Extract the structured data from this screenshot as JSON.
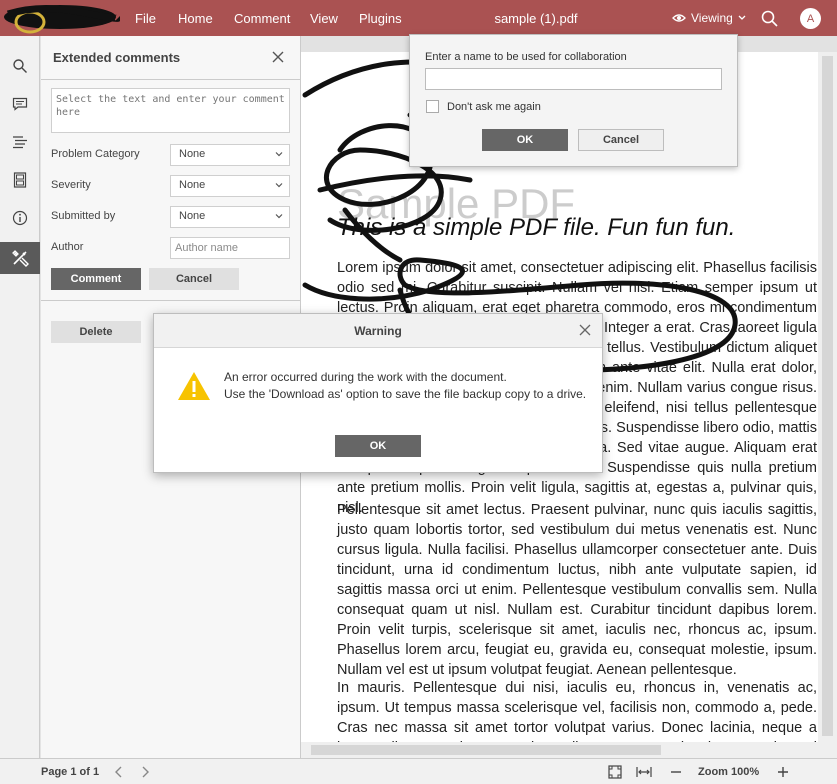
{
  "topbar": {
    "menu": [
      "File",
      "Home",
      "Comment",
      "View",
      "Plugins"
    ],
    "doc_title": "sample (1).pdf",
    "mode": "Viewing",
    "avatar": "A"
  },
  "panel": {
    "title": "Extended comments",
    "comment_placeholder": "Select the text and enter your comment here",
    "problem_category_label": "Problem Category",
    "problem_category_value": "None",
    "severity_label": "Severity",
    "severity_value": "None",
    "submitted_by_label": "Submitted by",
    "submitted_by_value": "None",
    "author_label": "Author",
    "author_placeholder": "Author name",
    "comment_button": "Comment",
    "cancel_button": "Cancel",
    "delete_button": "Delete"
  },
  "document": {
    "title": "Sample PDF",
    "subtitle": "This is a simple PDF file. Fun fun fun.",
    "paragraphs": [
      "Lorem ipsum dolor sit amet, consectetuer adipiscing elit. Phasellus facilisis odio sed mi. Curabitur suscipit. Nullam vel nisi. Etiam semper ipsum ut lectus. Proin aliquam, erat eget pharetra commodo, eros mi condimentum quam, sed commodo justo quam ut velit. Integer a erat. Cras laoreet ligula cursus enim. Aenean scelerisque velit et tellus. Vestibulum dictum aliquet sem. Nulla facilisi. Vestibulum accumsan ante vitae elit. Nulla erat dolor, blandit in, rutrum quis, semper pulvinar, enim. Nullam varius congue risus. Vivamus sollicitudin, metus ut interdum eleifend, nisi tellus pellentesque elit, tristique accumsan eros quam et risus. Suspendisse libero odio, mattis sit amet, aliquet eget, hendrerit vel, nulla. Sed vitae augue. Aliquam erat volutpat. Aliquam feugiat vulputate nisl. Suspendisse quis nulla pretium ante pretium mollis. Proin velit ligula, sagittis at, egestas a, pulvinar quis, nisl.",
      "Pellentesque sit amet lectus. Praesent pulvinar, nunc quis iaculis sagittis, justo quam lobortis tortor, sed vestibulum dui metus venenatis est. Nunc cursus ligula. Nulla facilisi. Phasellus ullamcorper consectetuer ante. Duis tincidunt, urna id condimentum luctus, nibh ante vulputate sapien, id sagittis massa orci ut enim. Pellentesque vestibulum convallis sem. Nulla consequat quam ut nisl. Nullam est. Curabitur tincidunt dapibus lorem. Proin velit turpis, scelerisque sit amet, iaculis nec, rhoncus ac, ipsum. Phasellus lorem arcu, feugiat eu, gravida eu, consequat molestie, ipsum. Nullam vel est ut ipsum volutpat feugiat. Aenean pellentesque.",
      "In mauris. Pellentesque dui nisi, iaculis eu, rhoncus in, venenatis ac, ipsum. Ut tempus massa scelerisque vel, facilisis non, commodo a, pede. Cras nec massa sit amet tortor volutpat varius. Donec lacinia, neque a luctus aliquet, pede massa imperdiet ante, at varius lorem pede sed sapien. Fusce erat nibh, aliquet in, eleifend eget, commodo eget, erat."
    ]
  },
  "collab_dialog": {
    "label": "Enter a name to be used for collaboration",
    "checkbox_label": "Don't ask me again",
    "ok": "OK",
    "cancel": "Cancel"
  },
  "warning_dialog": {
    "title": "Warning",
    "line1": "An error occurred during the work with the document.",
    "line2": "Use the 'Download as' option to save the file backup copy to a drive.",
    "ok": "OK"
  },
  "statusbar": {
    "page_info": "Page 1 of 1",
    "zoom": "Zoom 100%"
  },
  "colors": {
    "topbar": "#aa5252",
    "button_dark": "#666666",
    "warning_icon": "#f7c300"
  }
}
